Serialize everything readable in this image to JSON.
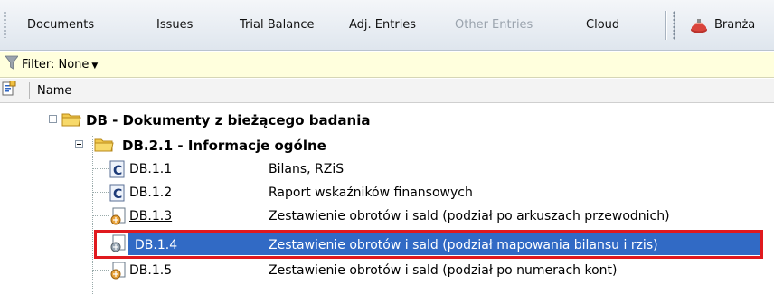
{
  "toolbar": {
    "documents": "Documents",
    "issues": "Issues",
    "trial_balance": "Trial Balance",
    "adj_entries": "Adj. Entries",
    "other_entries": "Other Entries",
    "cloud": "Cloud",
    "branza": "Branża"
  },
  "filter": {
    "label": "Filter: None",
    "caret": "▼"
  },
  "column": {
    "name": "Name"
  },
  "tree": {
    "root": {
      "label": "DB - Dokumenty z bieżącego badania"
    },
    "sub": {
      "label": "DB.2.1 - Informacje ogólne"
    },
    "items": [
      {
        "code": "DB.1.1",
        "desc": "Bilans, RZiS",
        "icon": "c-document-icon"
      },
      {
        "code": "DB.1.2",
        "desc": "Raport wskaźników finansowych",
        "icon": "c-document-icon"
      },
      {
        "code": "DB.1.3",
        "desc": "Zestawienie obrotów i sald (podział po arkuszach przewodnich)",
        "icon": "spreadsheet-doc-icon"
      },
      {
        "code": "DB.1.4",
        "desc": "Zestawienie obrotów i sald (podział mapowania bilansu i rzis)",
        "icon": "spreadsheet-doc-icon"
      },
      {
        "code": "DB.1.5",
        "desc": "Zestawienie obrotów i sald (podział po numerach kont)",
        "icon": "spreadsheet-doc-icon"
      }
    ]
  },
  "colors": {
    "selection": "#316ac5",
    "highlight_border": "#e0191e",
    "filter_bg": "#ffffdd"
  }
}
